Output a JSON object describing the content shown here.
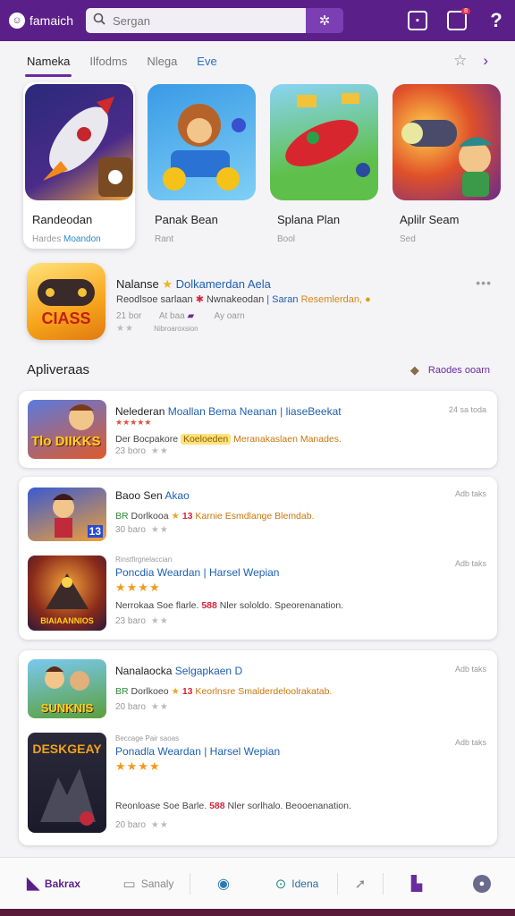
{
  "header": {
    "brand": "famaich",
    "search_placeholder": "Sergan",
    "notification_badge": "8"
  },
  "tabs": [
    {
      "label": "Nameka"
    },
    {
      "label": "Ilfodms"
    },
    {
      "label": "Nlega"
    },
    {
      "label": "Eve"
    }
  ],
  "featured": [
    {
      "name": "Randeodan",
      "sub1": "Hardes",
      "sub2": "Moandon"
    },
    {
      "name": "Panak Bean",
      "sub1": "Rant",
      "sub2": ""
    },
    {
      "name": "Splana Plan",
      "sub1": "Bool",
      "sub2": ""
    },
    {
      "name": "Aplilr Seam",
      "sub1": "Sed",
      "sub2": ""
    }
  ],
  "promo": {
    "icon_text": "CIASS",
    "title_a": "Nalanse",
    "title_b": "Dolkamerdan Aela",
    "desc_a": "Reodlsoe sarlaan",
    "desc_b": "Nwnakeodan",
    "desc_c": "| Saran",
    "desc_d": "Resemlerdan,",
    "meta_a": "21 bor",
    "meta_b": "At baa",
    "meta_c": "Ay oarn",
    "meta_d": "Nibroaroxsion"
  },
  "section": {
    "title": "Apliveraas",
    "link": "Raodes ooarn"
  },
  "list": [
    {
      "icon_text": "Tlo DIIKKS",
      "title_a": "Nelederan",
      "title_b": "Moallan Bema Neanan | liaseBeekat",
      "date": "24 sa toda",
      "sub": "★★★★★",
      "desc_a": "Der Bocpakore",
      "desc_badge": "Koeloeden",
      "desc_b": "Meranakaslaen Manades.",
      "meta": "23 boro"
    },
    {
      "icon_text": "13",
      "title_a": "Baoo Sen",
      "title_b": "Akao",
      "date": "Adb taks",
      "desc_pre": "BR",
      "desc_a": "Dorlkooa",
      "desc_red": "13",
      "desc_b": "Karnie Esmdlange Blemdab.",
      "meta": "30 baro"
    },
    {
      "icon_text": "BIAIAANNIOS",
      "title_top": "Rinstfirgnelaccian",
      "title_a": "Poncdia",
      "title_b": "Weardan | Harsel Wepian",
      "date": "Adb taks",
      "stars": "★★★★",
      "desc_a": "Nerrokaa Soe flarle.",
      "desc_red": "588",
      "desc_b": "Nler sololdo. Speorenanation.",
      "meta": "23 baro"
    },
    {
      "icon_text": "SUNKNIS",
      "title_a": "Nanalaocka",
      "title_b": "Selgapkaen D",
      "date": "Adb taks",
      "desc_pre": "BR",
      "desc_a": "Dorlkoeo",
      "desc_red": "13",
      "desc_b": "Keorlnsre Smalderdeloolrakatab.",
      "meta": "20 baro"
    },
    {
      "icon_text": "DESKGEAY",
      "title_top": "Beccage Pair saoas",
      "title_a": "Ponadla",
      "title_b": "Weardan | Harsel Wepian",
      "date": "Adb taks",
      "stars": "★★★★",
      "desc_a": "Reonloase Soe Barle.",
      "desc_red": "588",
      "desc_b": "Nler sorlhalo. Beooenanation.",
      "meta": "20 baro"
    }
  ],
  "bottom_nav": [
    {
      "label": "Bakrax"
    },
    {
      "label": "Sanaly"
    },
    {
      "label": ""
    },
    {
      "label": "Idena"
    },
    {
      "label": ""
    },
    {
      "label": ""
    },
    {
      "label": ""
    }
  ]
}
